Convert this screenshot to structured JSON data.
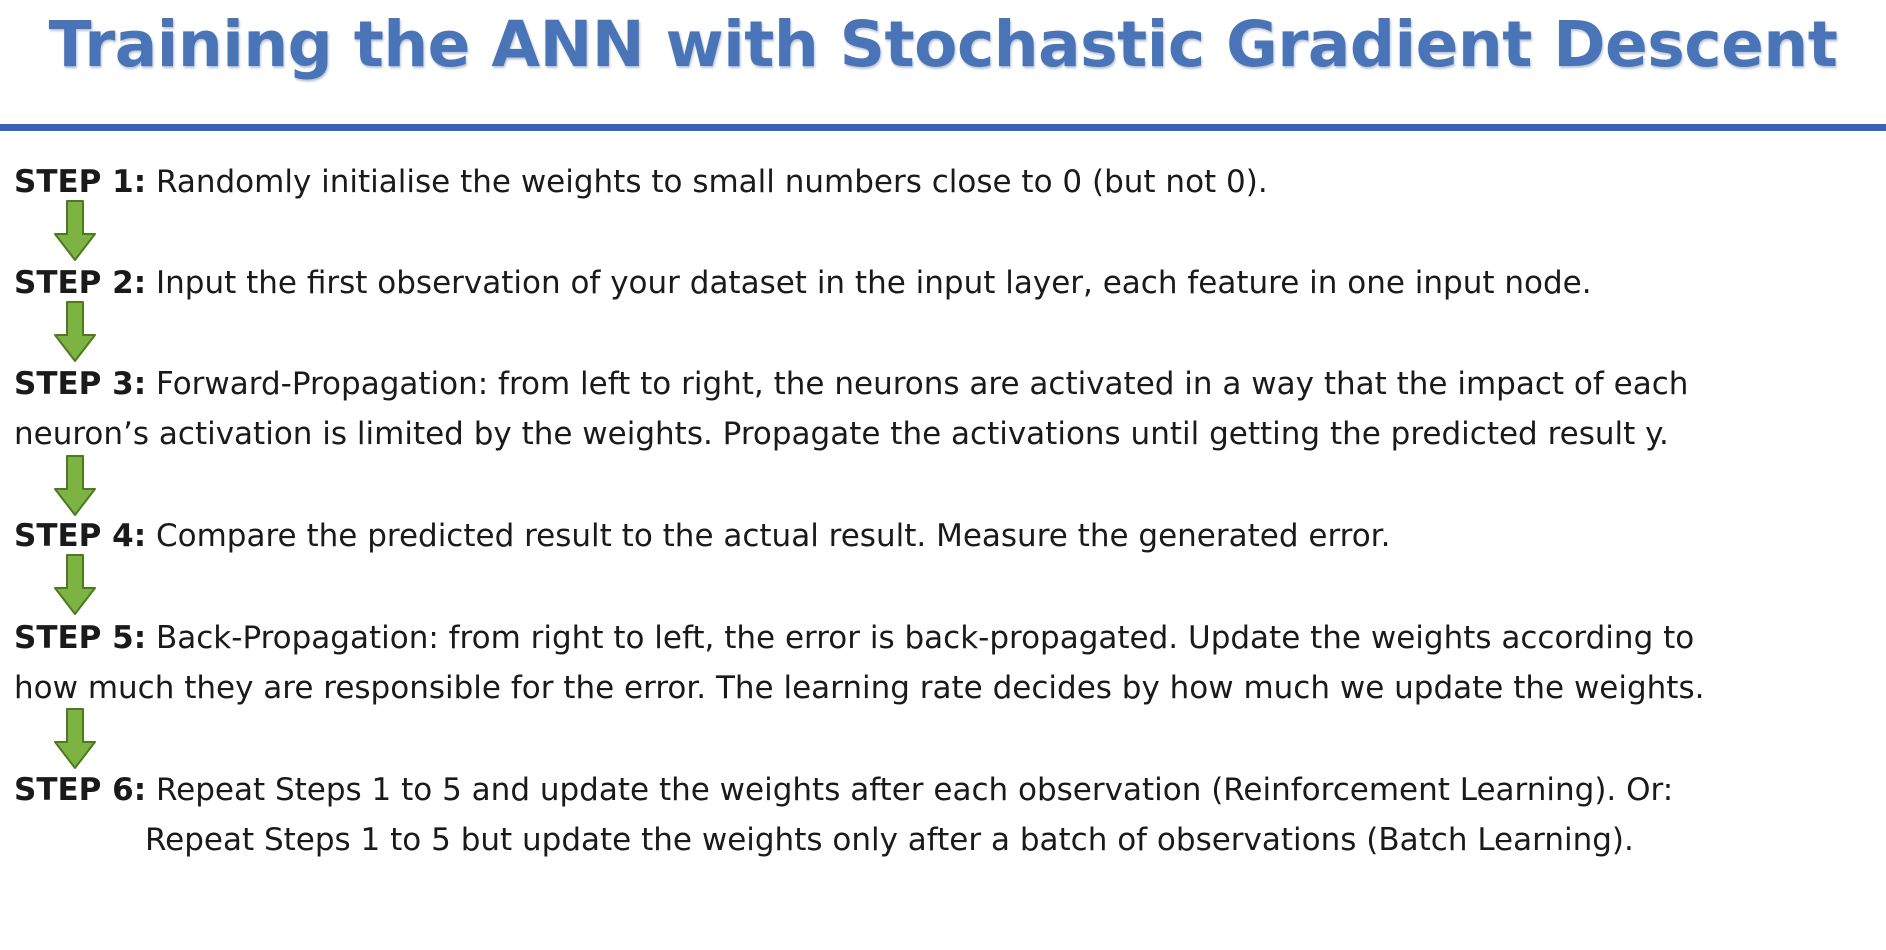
{
  "slide": {
    "title": "Training the ANN with Stochastic Gradient Descent",
    "accent_color": "#3a63b6",
    "title_color": "#4a74b8",
    "arrow_color": "#7cb342",
    "arrow_icon": "down-arrow-icon"
  },
  "steps": [
    {
      "label": "STEP 1:",
      "line1": " Randomly initialise the weights to small numbers close to 0 (but not 0)."
    },
    {
      "label": "STEP 2:",
      "line1": " Input the first observation of your dataset in the input layer, each feature in one input node."
    },
    {
      "label": "STEP 3:",
      "line1": " Forward-Propagation: from left to right, the neurons are activated in a way that the impact of each",
      "line2": "neuron’s activation is limited by the weights. Propagate the activations until getting the predicted result y."
    },
    {
      "label": "STEP 4:",
      "line1": " Compare the predicted result to the actual result. Measure the generated error."
    },
    {
      "label": "STEP 5:",
      "line1": " Back-Propagation: from right to left, the error is back-propagated. Update the weights according to",
      "line2": "how much they are responsible for the error. The learning rate decides by how much we update the weights."
    },
    {
      "label": "STEP 6:",
      "line1": " Repeat Steps 1 to 5 and update the weights after each observation (Reinforcement Learning). Or:",
      "line2": "Repeat Steps 1 to 5 but update the weights only after a batch of observations (Batch Learning)."
    }
  ]
}
